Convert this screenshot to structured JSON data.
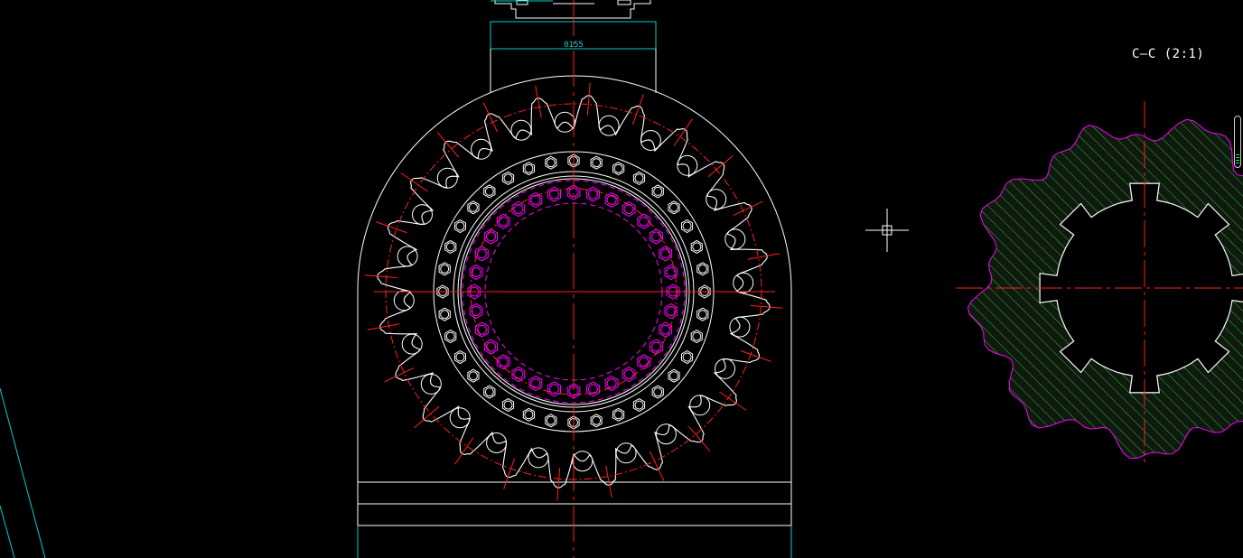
{
  "drawing": {
    "dimension_text": "0155",
    "section_label": "C—C (2:1)"
  },
  "colors": {
    "background": "#000000",
    "outline": "#ffffff",
    "centerline": "#ff0000",
    "holes": "#ff00ff",
    "dimension": "#00d0d0",
    "hatch": "#00ff00",
    "section_outline": "#ff00ff"
  },
  "cursor": {
    "icon": "crosshair-icon"
  }
}
